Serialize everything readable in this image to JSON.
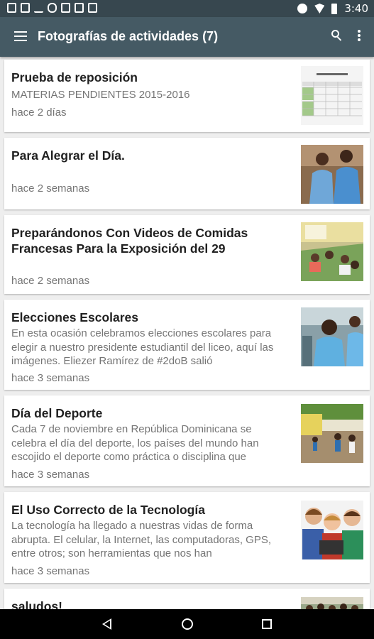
{
  "status_bar": {
    "time": "3:40",
    "left_icons": [
      "notification-icon",
      "screenshot-icon",
      "download-icon",
      "voicemail-icon",
      "image-icon",
      "gallery-icon",
      "shop-icon"
    ],
    "right_icons": [
      "sound-icon",
      "wifi-icon",
      "battery-icon"
    ]
  },
  "app_bar": {
    "title": "Fotografías de actividades (7)",
    "background": "#455a64"
  },
  "posts": [
    {
      "title": "Prueba de reposición",
      "excerpt": "MATERIAS PENDIENTES 2015-2016",
      "time": "hace 2 días",
      "thumbnail": "schedule-table-image"
    },
    {
      "title": "Para Alegrar el Día.",
      "excerpt": "",
      "time": "hace 2 semanas",
      "thumbnail": "students-photo"
    },
    {
      "title": "Preparándonos Con Videos de Comidas Francesas Para la Exposición del 29",
      "excerpt": "",
      "time": "hace 2 semanas",
      "thumbnail": "classroom-photo"
    },
    {
      "title": "Elecciones  Escolares",
      "excerpt": "En esta ocasión celebramos elecciones escolares para elegir a nuestro presidente estudiantil del liceo, aquí  las imágenes. Eliezer Ramírez de #2doB  salió",
      "time": "hace 3 semanas",
      "thumbnail": "election-photo"
    },
    {
      "title": "Día del Deporte",
      "excerpt": "Cada 7 de noviembre en República Dominicana se celebra el día del deporte, los países del mundo han escojido el deporte como práctica o disciplina que",
      "time": "hace 3 semanas",
      "thumbnail": "sports-photo"
    },
    {
      "title": "El Uso Correcto de la Tecnología",
      "excerpt": "La tecnología ha llegado a nuestras vidas de forma abrupta. El celular, la Internet, las computadoras, GPS, entre otros; son herramientas que nos han",
      "time": "hace 3 semanas",
      "thumbnail": "kids-tablet-photo"
    },
    {
      "title": "saludos!",
      "excerpt": "",
      "time": "",
      "thumbnail": "group-photo"
    }
  ]
}
